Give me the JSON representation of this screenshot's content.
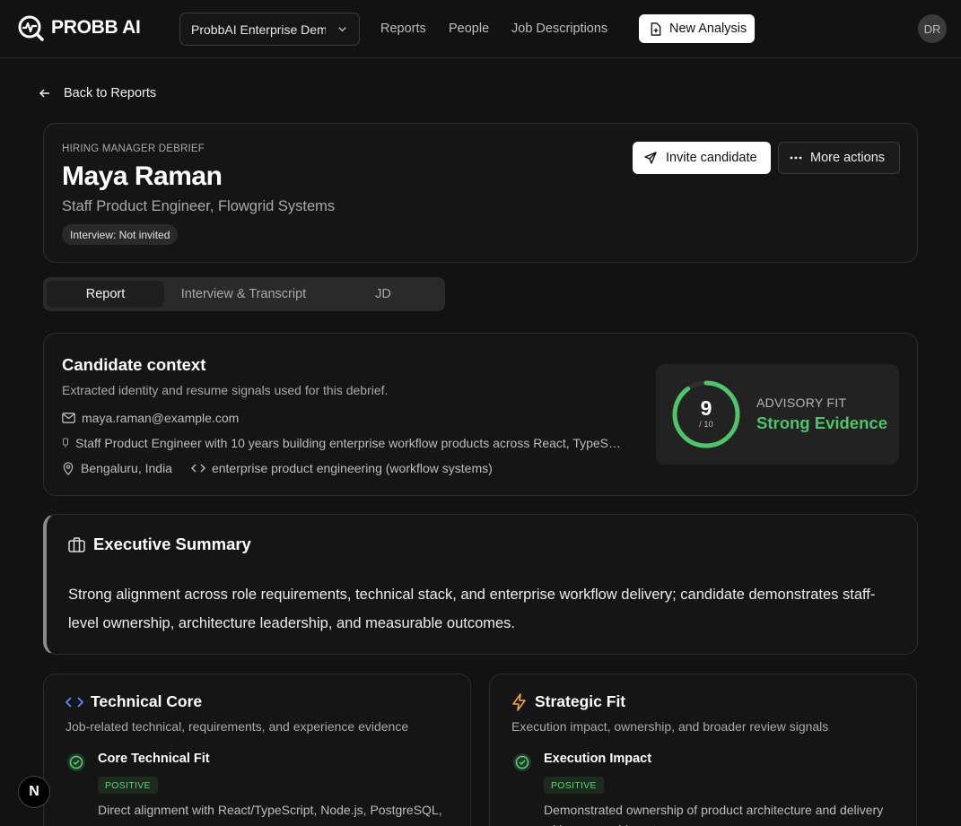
{
  "brand": {
    "name": "PROBB AI"
  },
  "topbar": {
    "org_select": "ProbbAI Enterprise Demo",
    "nav": [
      "Reports",
      "People",
      "Job Descriptions"
    ],
    "new_analysis": "New Analysis",
    "avatar_initials": "DR"
  },
  "back_link": "Back to Reports",
  "candidate": {
    "eyebrow": "HIRING MANAGER DEBRIEF",
    "name": "Maya Raman",
    "role": "Staff Product Engineer, Flowgrid Systems",
    "interview_status": "Interview: Not invited",
    "invite_label": "Invite candidate",
    "more_label": "More actions"
  },
  "tabs": [
    {
      "label": "Report",
      "active": true
    },
    {
      "label": "Interview & Transcript",
      "active": false
    },
    {
      "label": "JD",
      "active": false
    }
  ],
  "context": {
    "title": "Candidate context",
    "subtitle": "Extracted identity and resume signals used for this debrief.",
    "email": "maya.raman@example.com",
    "headline": "Staff Product Engineer with 10 years building enterprise workflow products across React, TypeS…",
    "location": "Bengaluru, India",
    "domain": "enterprise product engineering (workflow systems)"
  },
  "score": {
    "value": "9",
    "denominator": "/ 10",
    "label": "ADVISORY FIT",
    "verdict": "Strong Evidence",
    "fraction": 0.9,
    "accent": "#4fc46a"
  },
  "summary": {
    "title": "Executive Summary",
    "text": "Strong alignment across role requirements, technical stack, and enterprise workflow delivery; candidate demonstrates staff-level ownership, architecture leadership, and measurable outcomes."
  },
  "technical": {
    "title": "Technical Core",
    "subtitle": "Job-related technical, requirements, and experience evidence",
    "item_title": "Core Technical Fit",
    "badge": "POSITIVE",
    "item_desc": "Direct alignment with React/TypeScript, Node.js, PostgreSQL, ..."
  },
  "strategic": {
    "title": "Strategic Fit",
    "subtitle": "Execution impact, ownership, and broader review signals",
    "item_title": "Execution Impact",
    "badge": "POSITIVE",
    "item_desc": "Demonstrated ownership of product architecture and delivery with measurable outcomes ..."
  },
  "dev_badge": "N"
}
